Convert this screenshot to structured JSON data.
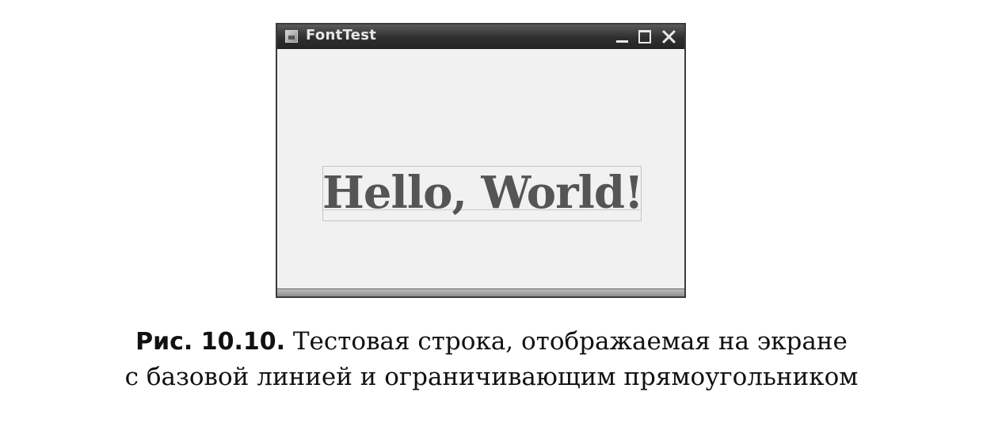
{
  "window": {
    "title": "FontTest",
    "icons": {
      "app": "java-app-icon",
      "minimize": "minimize-icon",
      "maximize": "maximize-icon",
      "close": "close-icon"
    },
    "content_text": "Hello, World!"
  },
  "caption": {
    "label": "Рис. 10.10.",
    "line1": "Тестовая строка, отображаемая на экране",
    "line2": "с базовой линией и ограничивающим прямоугольником"
  }
}
